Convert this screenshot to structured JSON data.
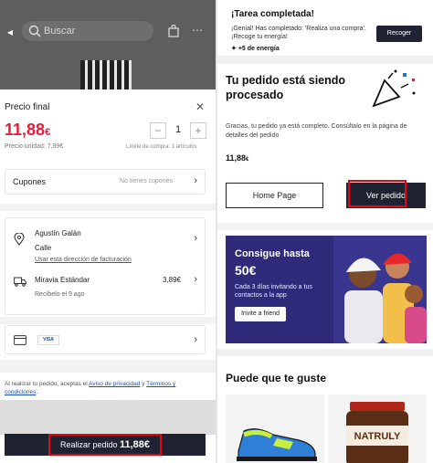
{
  "left": {
    "search": {
      "placeholder": "Buscar"
    },
    "price_title": "Precio final",
    "price_main": "11,88",
    "price_currency": "€",
    "quantity": "1",
    "unit_price": "Precio unidad: 7,99€",
    "limit": "Límite de compra: 1 artículos",
    "cupones": {
      "label": "Cupones",
      "value": "No tienes cupones"
    },
    "shipping": {
      "name": "Agustín Galán",
      "street": "Calle",
      "billing_link": "Usar esta dirección de facturación",
      "carrier": "Miravia Estándar",
      "carrier_price": "3,89€",
      "eta": "Recíbelo el 9 ago"
    },
    "payment": {
      "card_brand": "VISA"
    },
    "legal": {
      "prefix": "Al realizar tu pedido, aceptas el ",
      "privacy": "Aviso de privacidad",
      "and": " y ",
      "terms": "Términos y condiciones",
      "suffix": "."
    },
    "place_order": {
      "label": "Realizar pedido ",
      "amount": "11,88€"
    }
  },
  "right": {
    "toast": {
      "title": "¡Tarea completada!",
      "message": "¡Genial! Has completado: 'Realiza una compra'. ¡Recoge tu energía!",
      "reward": "+5 de energía",
      "button": "Recoger"
    },
    "processing_title": "Tu pedido está siendo procesado",
    "processing_text": "Gracias, tu pedido ya está completo. Consúltalo en la página de detalles del pedido",
    "price_main": "11,88",
    "price_currency": "€",
    "home_button": "Home Page",
    "view_order_button": "Ver pedido",
    "promo": {
      "title": "Consigue hasta",
      "amount": "50€",
      "text": "Cada 3 días invitando a tus contactos a la app",
      "button": "Invite a friend"
    },
    "suggest_title": "Puede que te guste",
    "products": [
      {
        "brand": "",
        "icon": "sneaker-image"
      },
      {
        "brand": "NATRULY",
        "icon": "jar-image"
      }
    ]
  },
  "colors": {
    "accent_red": "#e61e3c",
    "dark_button": "#1f2230",
    "highlight": "#e30613",
    "promo_bg": "#2f2b7a"
  }
}
